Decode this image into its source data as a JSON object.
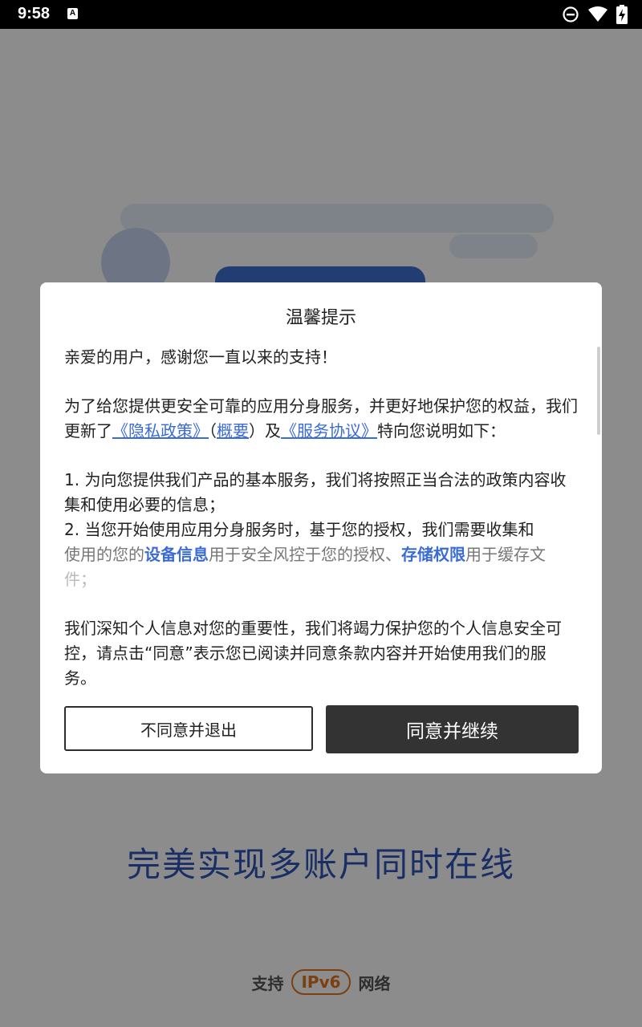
{
  "status_bar": {
    "time": "9:58",
    "notification_icon": "a-icon",
    "icons": [
      "dnd-icon",
      "wifi-icon",
      "battery-charging-icon"
    ]
  },
  "background": {
    "slogan": "完美实现多账户同时在线",
    "support_prefix": "支持",
    "ipv6_badge": "IPv6",
    "support_suffix": "网络"
  },
  "dialog": {
    "title": "温馨提示",
    "greeting": "亲爱的用户，感谢您一直以来的支持！",
    "intro_part1": "为了给您提供更安全可靠的应用分身服务，并更好地保护您的权益，我们更新了",
    "privacy_link": "《隐私政策》",
    "paren_open": "（",
    "summary_link": "概要",
    "paren_close": "）及",
    "service_link": "《服务协议》",
    "intro_part2": "特向您说明如下：",
    "point1": "1. 为向您提供我们产品的基本服务，我们将按照正当合法的政策内容收集和使用必要的信息；",
    "point2_part1": "2. 当您开始使用应用分身服务时，基于您的授权，我们需要收集和",
    "point2_part2": "使用的您的",
    "device_info_link": "设备信息",
    "point2_part3": "用于安全风控于您的授权、",
    "storage_link": "存储权限",
    "point2_part4": "用于缓存文",
    "point2_part5": "件；",
    "closing": "我们深知个人信息对您的重要性，我们将竭力保护您的个人信息安全可控，请点击“同意”表示您已阅读并同意条款内容并开始使用我们的服务。",
    "decline_label": "不同意并退出",
    "agree_label": "同意并继续"
  },
  "colors": {
    "link": "#3b6bd6",
    "primary_button": "#333333",
    "overlay": "rgba(0,0,0,0.45)",
    "slogan": "#2f55b8",
    "ipv6": "#e0741e"
  }
}
